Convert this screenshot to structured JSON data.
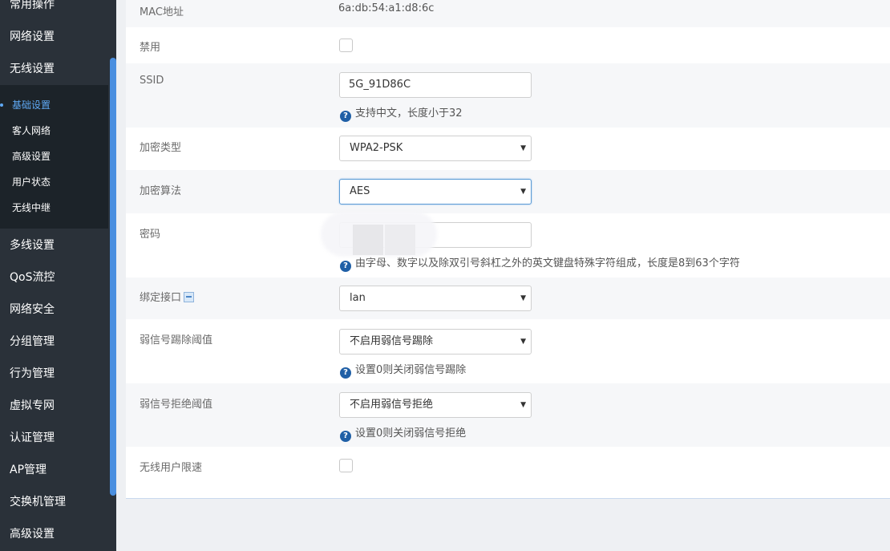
{
  "sidebar": {
    "top_items": [
      {
        "label": "常用操作"
      },
      {
        "label": "网络设置"
      },
      {
        "label": "无线设置"
      }
    ],
    "sub_items": [
      {
        "label": "基础设置",
        "active": true
      },
      {
        "label": "客人网络"
      },
      {
        "label": "高级设置"
      },
      {
        "label": "用户状态"
      },
      {
        "label": "无线中继"
      }
    ],
    "bottom_items": [
      {
        "label": "多线设置"
      },
      {
        "label": "QoS流控"
      },
      {
        "label": "网络安全"
      },
      {
        "label": "分组管理"
      },
      {
        "label": "行为管理"
      },
      {
        "label": "虚拟专网"
      },
      {
        "label": "认证管理"
      },
      {
        "label": "AP管理"
      },
      {
        "label": "交换机管理"
      },
      {
        "label": "高级设置"
      }
    ]
  },
  "form": {
    "mac": {
      "label": "MAC地址",
      "value": "6a:db:54:a1:d8:6c"
    },
    "disable": {
      "label": "禁用"
    },
    "ssid": {
      "label": "SSID",
      "value": "5G_91D86C",
      "hint": "支持中文，长度小于32"
    },
    "encryption_type": {
      "label": "加密类型",
      "value": "WPA2-PSK"
    },
    "encryption_algo": {
      "label": "加密算法",
      "value": "AES"
    },
    "password": {
      "label": "密码",
      "hint": "由字母、数字以及除双引号斜杠之外的英文键盘特殊字符组成，长度是8到63个字符"
    },
    "bind_interface": {
      "label": "绑定接口",
      "value": "lan"
    },
    "weak_kick": {
      "label": "弱信号踢除阈值",
      "value": "不启用弱信号踢除",
      "hint": "设置0则关闭弱信号踢除"
    },
    "weak_reject": {
      "label": "弱信号拒绝阈值",
      "value": "不启用弱信号拒绝",
      "hint": "设置0则关闭弱信号拒绝"
    },
    "rate_limit": {
      "label": "无线用户限速"
    }
  },
  "icons": {
    "help": "question-circle-icon",
    "caret": "caret-down-icon",
    "link": "link-icon"
  },
  "colors": {
    "sidebar_bg": "#2a3139",
    "submenu_bg": "#1c2329",
    "accent": "#5fa9f5",
    "help_icon": "#1f5fa6"
  }
}
